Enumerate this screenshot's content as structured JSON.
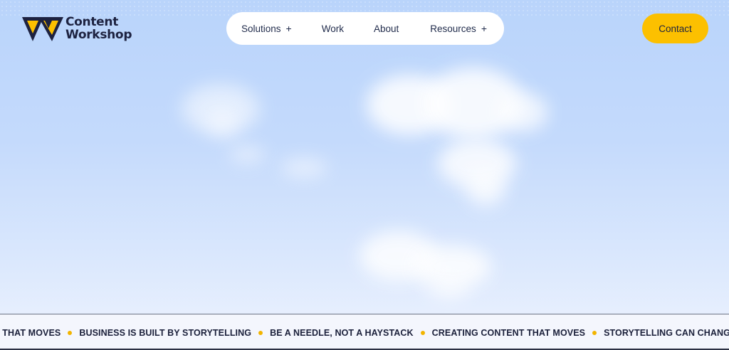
{
  "brand": {
    "line1": "Content",
    "line2": "Workshop",
    "logo_icon": "w-chevron-logo",
    "colors": {
      "yellow": "#fcc000",
      "navy": "#1d2240"
    }
  },
  "nav": {
    "items": [
      {
        "label": "Solutions",
        "has_submenu": true,
        "expand_symbol": "+"
      },
      {
        "label": "Work",
        "has_submenu": false
      },
      {
        "label": "About",
        "has_submenu": false
      },
      {
        "label": "Resources",
        "has_submenu": true,
        "expand_symbol": "+"
      }
    ]
  },
  "cta": {
    "label": "Contact",
    "color": "#fcc000"
  },
  "hero": {
    "background": "sky-with-clouds",
    "sky_color": "#c4dafc"
  },
  "ticker": {
    "items": [
      "T THAT MOVES",
      "BUSINESS IS BUILT BY STORYTELLING",
      "BE A NEEDLE, NOT A HAYSTACK",
      "CREATING CONTENT THAT MOVES",
      "STORYTELLING CAN CHANGE THE W"
    ],
    "separator_color": "#f2b400"
  }
}
